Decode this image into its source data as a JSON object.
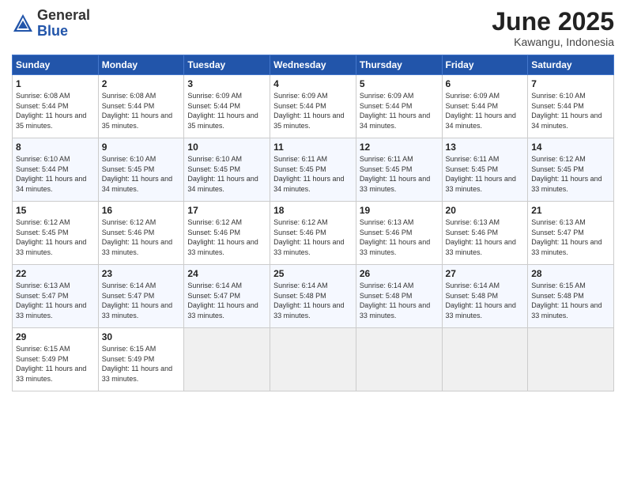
{
  "header": {
    "logo_general": "General",
    "logo_blue": "Blue",
    "month_title": "June 2025",
    "location": "Kawangu, Indonesia"
  },
  "days_of_week": [
    "Sunday",
    "Monday",
    "Tuesday",
    "Wednesday",
    "Thursday",
    "Friday",
    "Saturday"
  ],
  "weeks": [
    [
      {
        "day": "1",
        "sunrise": "6:08 AM",
        "sunset": "5:44 PM",
        "daylight": "11 hours and 35 minutes."
      },
      {
        "day": "2",
        "sunrise": "6:08 AM",
        "sunset": "5:44 PM",
        "daylight": "11 hours and 35 minutes."
      },
      {
        "day": "3",
        "sunrise": "6:09 AM",
        "sunset": "5:44 PM",
        "daylight": "11 hours and 35 minutes."
      },
      {
        "day": "4",
        "sunrise": "6:09 AM",
        "sunset": "5:44 PM",
        "daylight": "11 hours and 35 minutes."
      },
      {
        "day": "5",
        "sunrise": "6:09 AM",
        "sunset": "5:44 PM",
        "daylight": "11 hours and 34 minutes."
      },
      {
        "day": "6",
        "sunrise": "6:09 AM",
        "sunset": "5:44 PM",
        "daylight": "11 hours and 34 minutes."
      },
      {
        "day": "7",
        "sunrise": "6:10 AM",
        "sunset": "5:44 PM",
        "daylight": "11 hours and 34 minutes."
      }
    ],
    [
      {
        "day": "8",
        "sunrise": "6:10 AM",
        "sunset": "5:44 PM",
        "daylight": "11 hours and 34 minutes."
      },
      {
        "day": "9",
        "sunrise": "6:10 AM",
        "sunset": "5:45 PM",
        "daylight": "11 hours and 34 minutes."
      },
      {
        "day": "10",
        "sunrise": "6:10 AM",
        "sunset": "5:45 PM",
        "daylight": "11 hours and 34 minutes."
      },
      {
        "day": "11",
        "sunrise": "6:11 AM",
        "sunset": "5:45 PM",
        "daylight": "11 hours and 34 minutes."
      },
      {
        "day": "12",
        "sunrise": "6:11 AM",
        "sunset": "5:45 PM",
        "daylight": "11 hours and 33 minutes."
      },
      {
        "day": "13",
        "sunrise": "6:11 AM",
        "sunset": "5:45 PM",
        "daylight": "11 hours and 33 minutes."
      },
      {
        "day": "14",
        "sunrise": "6:12 AM",
        "sunset": "5:45 PM",
        "daylight": "11 hours and 33 minutes."
      }
    ],
    [
      {
        "day": "15",
        "sunrise": "6:12 AM",
        "sunset": "5:45 PM",
        "daylight": "11 hours and 33 minutes."
      },
      {
        "day": "16",
        "sunrise": "6:12 AM",
        "sunset": "5:46 PM",
        "daylight": "11 hours and 33 minutes."
      },
      {
        "day": "17",
        "sunrise": "6:12 AM",
        "sunset": "5:46 PM",
        "daylight": "11 hours and 33 minutes."
      },
      {
        "day": "18",
        "sunrise": "6:12 AM",
        "sunset": "5:46 PM",
        "daylight": "11 hours and 33 minutes."
      },
      {
        "day": "19",
        "sunrise": "6:13 AM",
        "sunset": "5:46 PM",
        "daylight": "11 hours and 33 minutes."
      },
      {
        "day": "20",
        "sunrise": "6:13 AM",
        "sunset": "5:46 PM",
        "daylight": "11 hours and 33 minutes."
      },
      {
        "day": "21",
        "sunrise": "6:13 AM",
        "sunset": "5:47 PM",
        "daylight": "11 hours and 33 minutes."
      }
    ],
    [
      {
        "day": "22",
        "sunrise": "6:13 AM",
        "sunset": "5:47 PM",
        "daylight": "11 hours and 33 minutes."
      },
      {
        "day": "23",
        "sunrise": "6:14 AM",
        "sunset": "5:47 PM",
        "daylight": "11 hours and 33 minutes."
      },
      {
        "day": "24",
        "sunrise": "6:14 AM",
        "sunset": "5:47 PM",
        "daylight": "11 hours and 33 minutes."
      },
      {
        "day": "25",
        "sunrise": "6:14 AM",
        "sunset": "5:48 PM",
        "daylight": "11 hours and 33 minutes."
      },
      {
        "day": "26",
        "sunrise": "6:14 AM",
        "sunset": "5:48 PM",
        "daylight": "11 hours and 33 minutes."
      },
      {
        "day": "27",
        "sunrise": "6:14 AM",
        "sunset": "5:48 PM",
        "daylight": "11 hours and 33 minutes."
      },
      {
        "day": "28",
        "sunrise": "6:15 AM",
        "sunset": "5:48 PM",
        "daylight": "11 hours and 33 minutes."
      }
    ],
    [
      {
        "day": "29",
        "sunrise": "6:15 AM",
        "sunset": "5:49 PM",
        "daylight": "11 hours and 33 minutes."
      },
      {
        "day": "30",
        "sunrise": "6:15 AM",
        "sunset": "5:49 PM",
        "daylight": "11 hours and 33 minutes."
      },
      null,
      null,
      null,
      null,
      null
    ]
  ]
}
